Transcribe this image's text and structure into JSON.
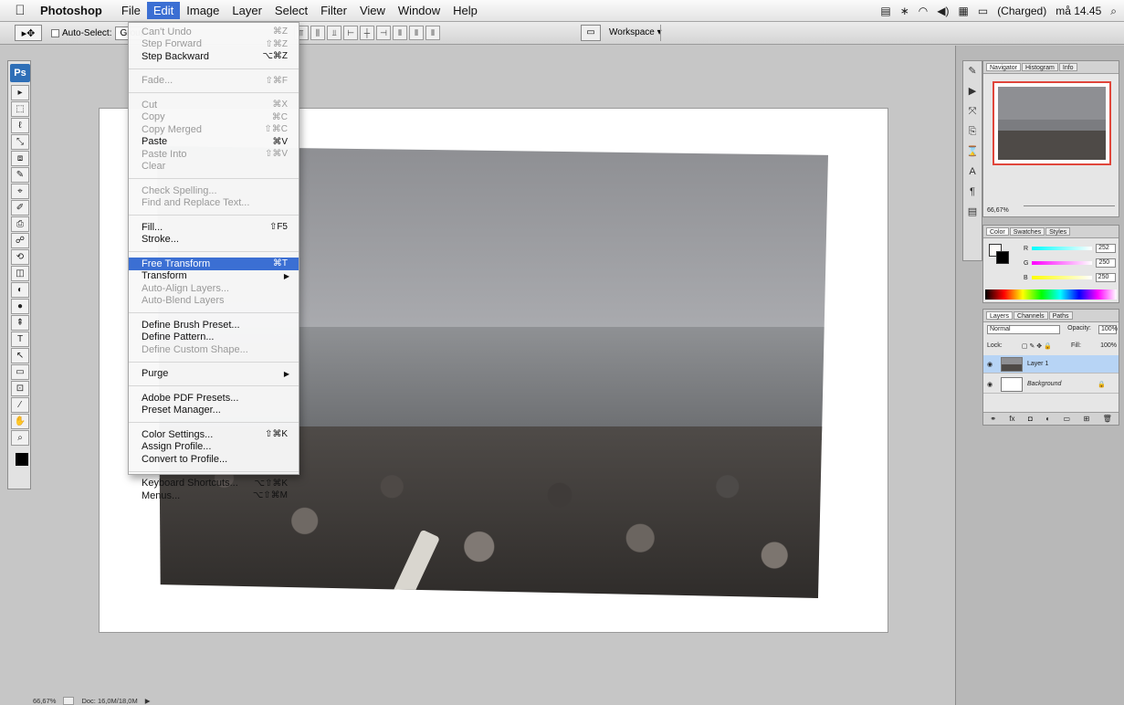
{
  "menubar": {
    "app_name": "Photoshop",
    "menus": [
      "File",
      "Edit",
      "Image",
      "Layer",
      "Select",
      "Filter",
      "View",
      "Window",
      "Help"
    ],
    "active_menu": "Edit",
    "status": {
      "battery": "(Charged)",
      "clock": "må 14.45"
    }
  },
  "options_bar": {
    "auto_select_label": "Auto-Select:",
    "auto_select_value": "Group",
    "workspace_label": "Workspace ▾"
  },
  "edit_menu": {
    "items": [
      {
        "label": "Can't Undo",
        "shortcut": "⌘Z",
        "enabled": false
      },
      {
        "label": "Step Forward",
        "shortcut": "⇧⌘Z",
        "enabled": false
      },
      {
        "label": "Step Backward",
        "shortcut": "⌥⌘Z",
        "enabled": true
      },
      {
        "sep": true
      },
      {
        "label": "Fade...",
        "shortcut": "⇧⌘F",
        "enabled": false
      },
      {
        "sep": true
      },
      {
        "label": "Cut",
        "shortcut": "⌘X",
        "enabled": false
      },
      {
        "label": "Copy",
        "shortcut": "⌘C",
        "enabled": false
      },
      {
        "label": "Copy Merged",
        "shortcut": "⇧⌘C",
        "enabled": false
      },
      {
        "label": "Paste",
        "shortcut": "⌘V",
        "enabled": true
      },
      {
        "label": "Paste Into",
        "shortcut": "⇧⌘V",
        "enabled": false
      },
      {
        "label": "Clear",
        "shortcut": "",
        "enabled": false
      },
      {
        "sep": true
      },
      {
        "label": "Check Spelling...",
        "shortcut": "",
        "enabled": false
      },
      {
        "label": "Find and Replace Text...",
        "shortcut": "",
        "enabled": false
      },
      {
        "sep": true
      },
      {
        "label": "Fill...",
        "shortcut": "⇧F5",
        "enabled": true
      },
      {
        "label": "Stroke...",
        "shortcut": "",
        "enabled": true
      },
      {
        "sep": true
      },
      {
        "label": "Free Transform",
        "shortcut": "⌘T",
        "enabled": true,
        "highlight": true
      },
      {
        "label": "Transform",
        "shortcut": "",
        "enabled": true,
        "submenu": true
      },
      {
        "label": "Auto-Align Layers...",
        "shortcut": "",
        "enabled": false
      },
      {
        "label": "Auto-Blend Layers",
        "shortcut": "",
        "enabled": false
      },
      {
        "sep": true
      },
      {
        "label": "Define Brush Preset...",
        "shortcut": "",
        "enabled": true
      },
      {
        "label": "Define Pattern...",
        "shortcut": "",
        "enabled": true
      },
      {
        "label": "Define Custom Shape...",
        "shortcut": "",
        "enabled": false
      },
      {
        "sep": true
      },
      {
        "label": "Purge",
        "shortcut": "",
        "enabled": true,
        "submenu": true
      },
      {
        "sep": true
      },
      {
        "label": "Adobe PDF Presets...",
        "shortcut": "",
        "enabled": true
      },
      {
        "label": "Preset Manager...",
        "shortcut": "",
        "enabled": true
      },
      {
        "sep": true
      },
      {
        "label": "Color Settings...",
        "shortcut": "⇧⌘K",
        "enabled": true
      },
      {
        "label": "Assign Profile...",
        "shortcut": "",
        "enabled": true
      },
      {
        "label": "Convert to Profile...",
        "shortcut": "",
        "enabled": true
      },
      {
        "sep": true
      },
      {
        "label": "Keyboard Shortcuts...",
        "shortcut": "⌥⇧⌘K",
        "enabled": true
      },
      {
        "label": "Menus...",
        "shortcut": "⌥⇧⌘M",
        "enabled": true
      }
    ]
  },
  "toolbox": {
    "logo": "Ps",
    "tools": [
      "▸",
      "⬚",
      "ℓ",
      "⤡",
      "⧈",
      "✎",
      "⌖",
      "✐",
      "⎙",
      "☍",
      "⟲",
      "◫",
      "◐",
      "●",
      "⇞",
      "T",
      "↖",
      "▭",
      "⊡",
      "⁄",
      "✋",
      "⌕"
    ]
  },
  "statusbar": {
    "zoom": "66,67%",
    "doc": "Doc: 16,0M/18,0M"
  },
  "navigator_panel": {
    "tabs": [
      "Navigator",
      "Histogram",
      "Info"
    ],
    "zoom": "66,67%"
  },
  "color_panel": {
    "tabs": [
      "Color",
      "Swatches",
      "Styles"
    ],
    "channels": [
      {
        "name": "R",
        "value": "252"
      },
      {
        "name": "G",
        "value": "250"
      },
      {
        "name": "B",
        "value": "250"
      }
    ]
  },
  "layers_panel": {
    "tabs": [
      "Layers",
      "Channels",
      "Paths"
    ],
    "blend_mode": "Normal",
    "opacity_label": "Opacity:",
    "opacity": "100%",
    "lock_label": "Lock:",
    "fill_label": "Fill:",
    "fill": "100%",
    "layers": [
      {
        "name": "Layer 1",
        "selected": true
      },
      {
        "name": "Background",
        "selected": false
      }
    ]
  },
  "colors": {
    "menu_highlight": "#3b6fd3",
    "navigator_frame": "#e0463b",
    "selected_layer": "#b7d4f5"
  }
}
